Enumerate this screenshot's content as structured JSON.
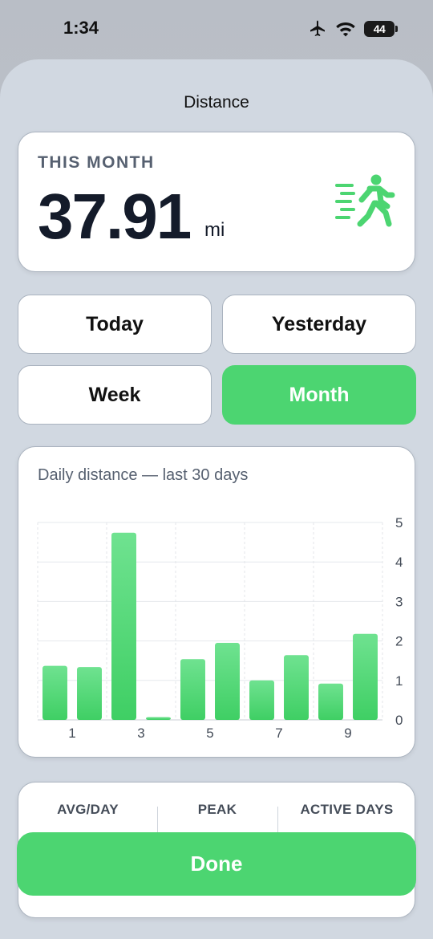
{
  "status_bar": {
    "time": "1:34",
    "battery_level": "44"
  },
  "sheet": {
    "title": "Distance"
  },
  "summary": {
    "label": "THIS MONTH",
    "value": "37.91",
    "unit": "mi",
    "icon": "walking-figure-icon"
  },
  "segments": [
    {
      "label": "Today",
      "selected": false
    },
    {
      "label": "Yesterday",
      "selected": false
    },
    {
      "label": "Week",
      "selected": false
    },
    {
      "label": "Month",
      "selected": true
    }
  ],
  "chart": {
    "title": "Daily distance — last 30 days"
  },
  "chart_data": {
    "type": "bar",
    "title": "Daily distance — last 30 days",
    "x": [
      1,
      2,
      3,
      4,
      5,
      6,
      7,
      8,
      9,
      10
    ],
    "x_tick_labels": [
      "1",
      "3",
      "5",
      "7",
      "9"
    ],
    "values": [
      1.37,
      1.34,
      4.74,
      0.07,
      1.54,
      1.95,
      1.0,
      1.64,
      0.92,
      2.18
    ],
    "ylim": [
      0,
      5
    ],
    "y_ticks": [
      0,
      1,
      2,
      3,
      4,
      5
    ],
    "grid": true,
    "bar_color": "#4cd571"
  },
  "stats": [
    {
      "label": "AVG/DAY"
    },
    {
      "label": "PEAK"
    },
    {
      "label": "ACTIVE DAYS"
    }
  ],
  "done_label": "Done",
  "colors": {
    "accent": "#4cd571",
    "sheet_bg": "#d1d8e1",
    "text_muted": "#566070"
  }
}
